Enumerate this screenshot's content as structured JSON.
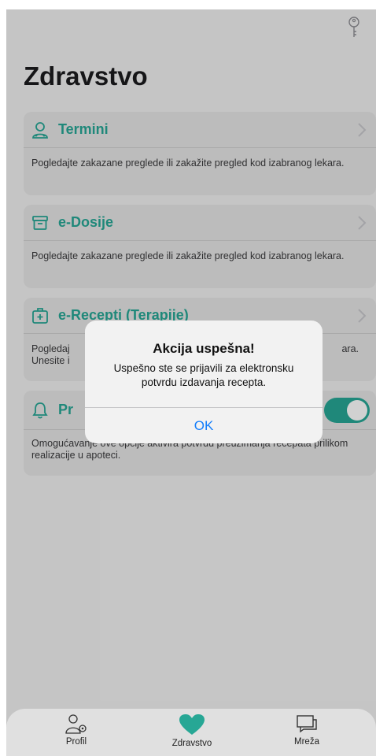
{
  "header": {
    "title": "Zdravstvo",
    "key_icon": "key-icon"
  },
  "cards": [
    {
      "title": "Termini",
      "icon": "doctor-icon",
      "description": "Pogledajte zakazane preglede ili zakažite pregled kod izabranog lekara."
    },
    {
      "title": "e-Dosije",
      "icon": "archive-box-icon",
      "description": "Pogledajte zakazane preglede ili zakažite pregled kod izabranog lekara."
    },
    {
      "title": "e-Recepti (Terapije)",
      "icon": "medical-kit-icon",
      "description_left": "Pogledaj",
      "description_left2": "Unesite i",
      "description_right": "ara."
    },
    {
      "title": "Pr",
      "icon": "bell-icon",
      "toggle_on": true,
      "description": "Omogućavanje ove opcije aktivira potvrdu preuzimanja recepata prilikom realizacije u apoteci."
    }
  ],
  "alert": {
    "title": "Akcija uspešna!",
    "message": "Uspešno ste se prijavili za elektronsku potvrdu izdavanja recepta.",
    "ok_label": "OK"
  },
  "tabbar": {
    "tabs": [
      {
        "label": "Profil",
        "icon": "profile-settings-icon"
      },
      {
        "label": "Zdravstvo",
        "icon": "heart-icon",
        "active": true
      },
      {
        "label": "Mreža",
        "icon": "chat-bubbles-icon"
      }
    ]
  },
  "colors": {
    "accent": "#27a795",
    "link": "#147efb",
    "card_bg": "#e6e6e6"
  }
}
